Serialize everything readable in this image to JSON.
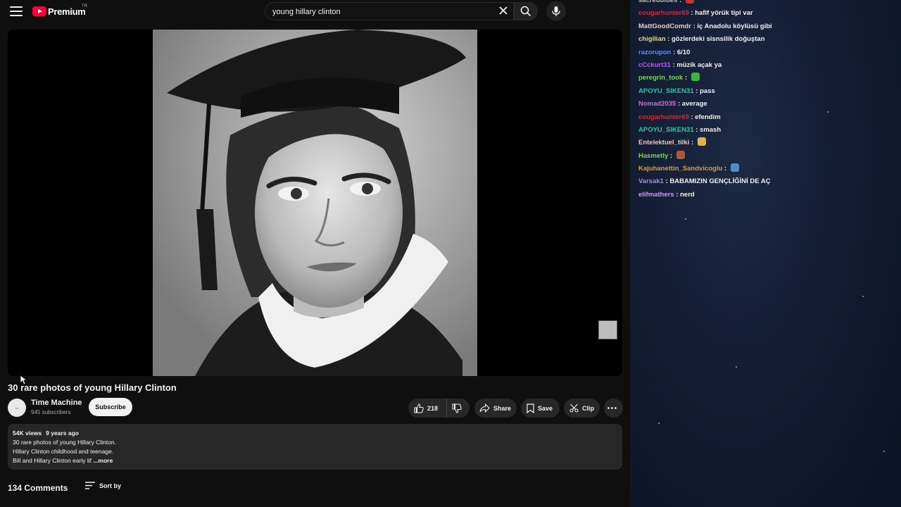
{
  "search": {
    "query": "young hillary clinton"
  },
  "logo": {
    "text": "Premium",
    "country": "TR"
  },
  "video": {
    "title": "30 rare photos of young Hillary Clinton",
    "channel_name": "Time Machine",
    "channel_subs": "945 subscribers",
    "subscribe_label": "Subscribe",
    "likes": "218",
    "share_label": "Share",
    "save_label": "Save",
    "clip_label": "Clip"
  },
  "description": {
    "views": "54K views",
    "age": "9 years ago",
    "line1": "30 rare photos of young Hillary Clinton.",
    "line2": "Hillary Clinton childhood and teenage.",
    "line3": "Bill and Hillary Clinton early lif",
    "more_label": "...more"
  },
  "comments": {
    "count_label": "134 Comments",
    "sort_label": "Sort by"
  },
  "chat": {
    "messages": [
      {
        "user": "sacredblues",
        "color": "#b8b8b8",
        "text": " : ",
        "emote": "#c0392b"
      },
      {
        "user": "cougarhunter69",
        "color": "#d1283c",
        "text": " : hafif yörük tipi var"
      },
      {
        "user": "MattGoodComdr",
        "color": "#f0c9c9",
        "text": " : iç Anadolu köylüsü gibi"
      },
      {
        "user": "chigilian",
        "color": "#f5d76e",
        "text": " : gözlerdeki sisnsilik doğuştan"
      },
      {
        "user": "razorupon",
        "color": "#5b8def",
        "text": " : 6/10"
      },
      {
        "user": "cCckurt31",
        "color": "#a95de8",
        "text": " : müzik açak ya"
      },
      {
        "user": "peregrin_took",
        "color": "#7cd45a",
        "text": " : ",
        "emote": "#3cb43c"
      },
      {
        "user": "APOYU_SIKEN31",
        "color": "#2ec4a6",
        "text": " : pass"
      },
      {
        "user": "Nomad2035",
        "color": "#d26bd0",
        "text": " : average"
      },
      {
        "user": "cougarhunter69",
        "color": "#d1283c",
        "text": " : efendim"
      },
      {
        "user": "APOYU_SIKEN31",
        "color": "#2ec4a6",
        "text": " : smash"
      },
      {
        "user": "Entelektuel_tilki",
        "color": "#e0c8c8",
        "text": " : ",
        "emote": "#e0b34a"
      },
      {
        "user": "Hasmetly",
        "color": "#63e05a",
        "text": " : ",
        "emote": "#b0563a"
      },
      {
        "user": "Kajuhanettin_Sandvicoglu",
        "color": "#e39a3a",
        "text": " : ",
        "emote": "#4a90c8"
      },
      {
        "user": "Varsak1",
        "color": "#b584e0",
        "text": " : BABAMIZIN GENÇLİĞİNİ DE AÇ"
      },
      {
        "user": "elifmathers",
        "color": "#c99cf0",
        "text": " : nerd"
      }
    ]
  }
}
